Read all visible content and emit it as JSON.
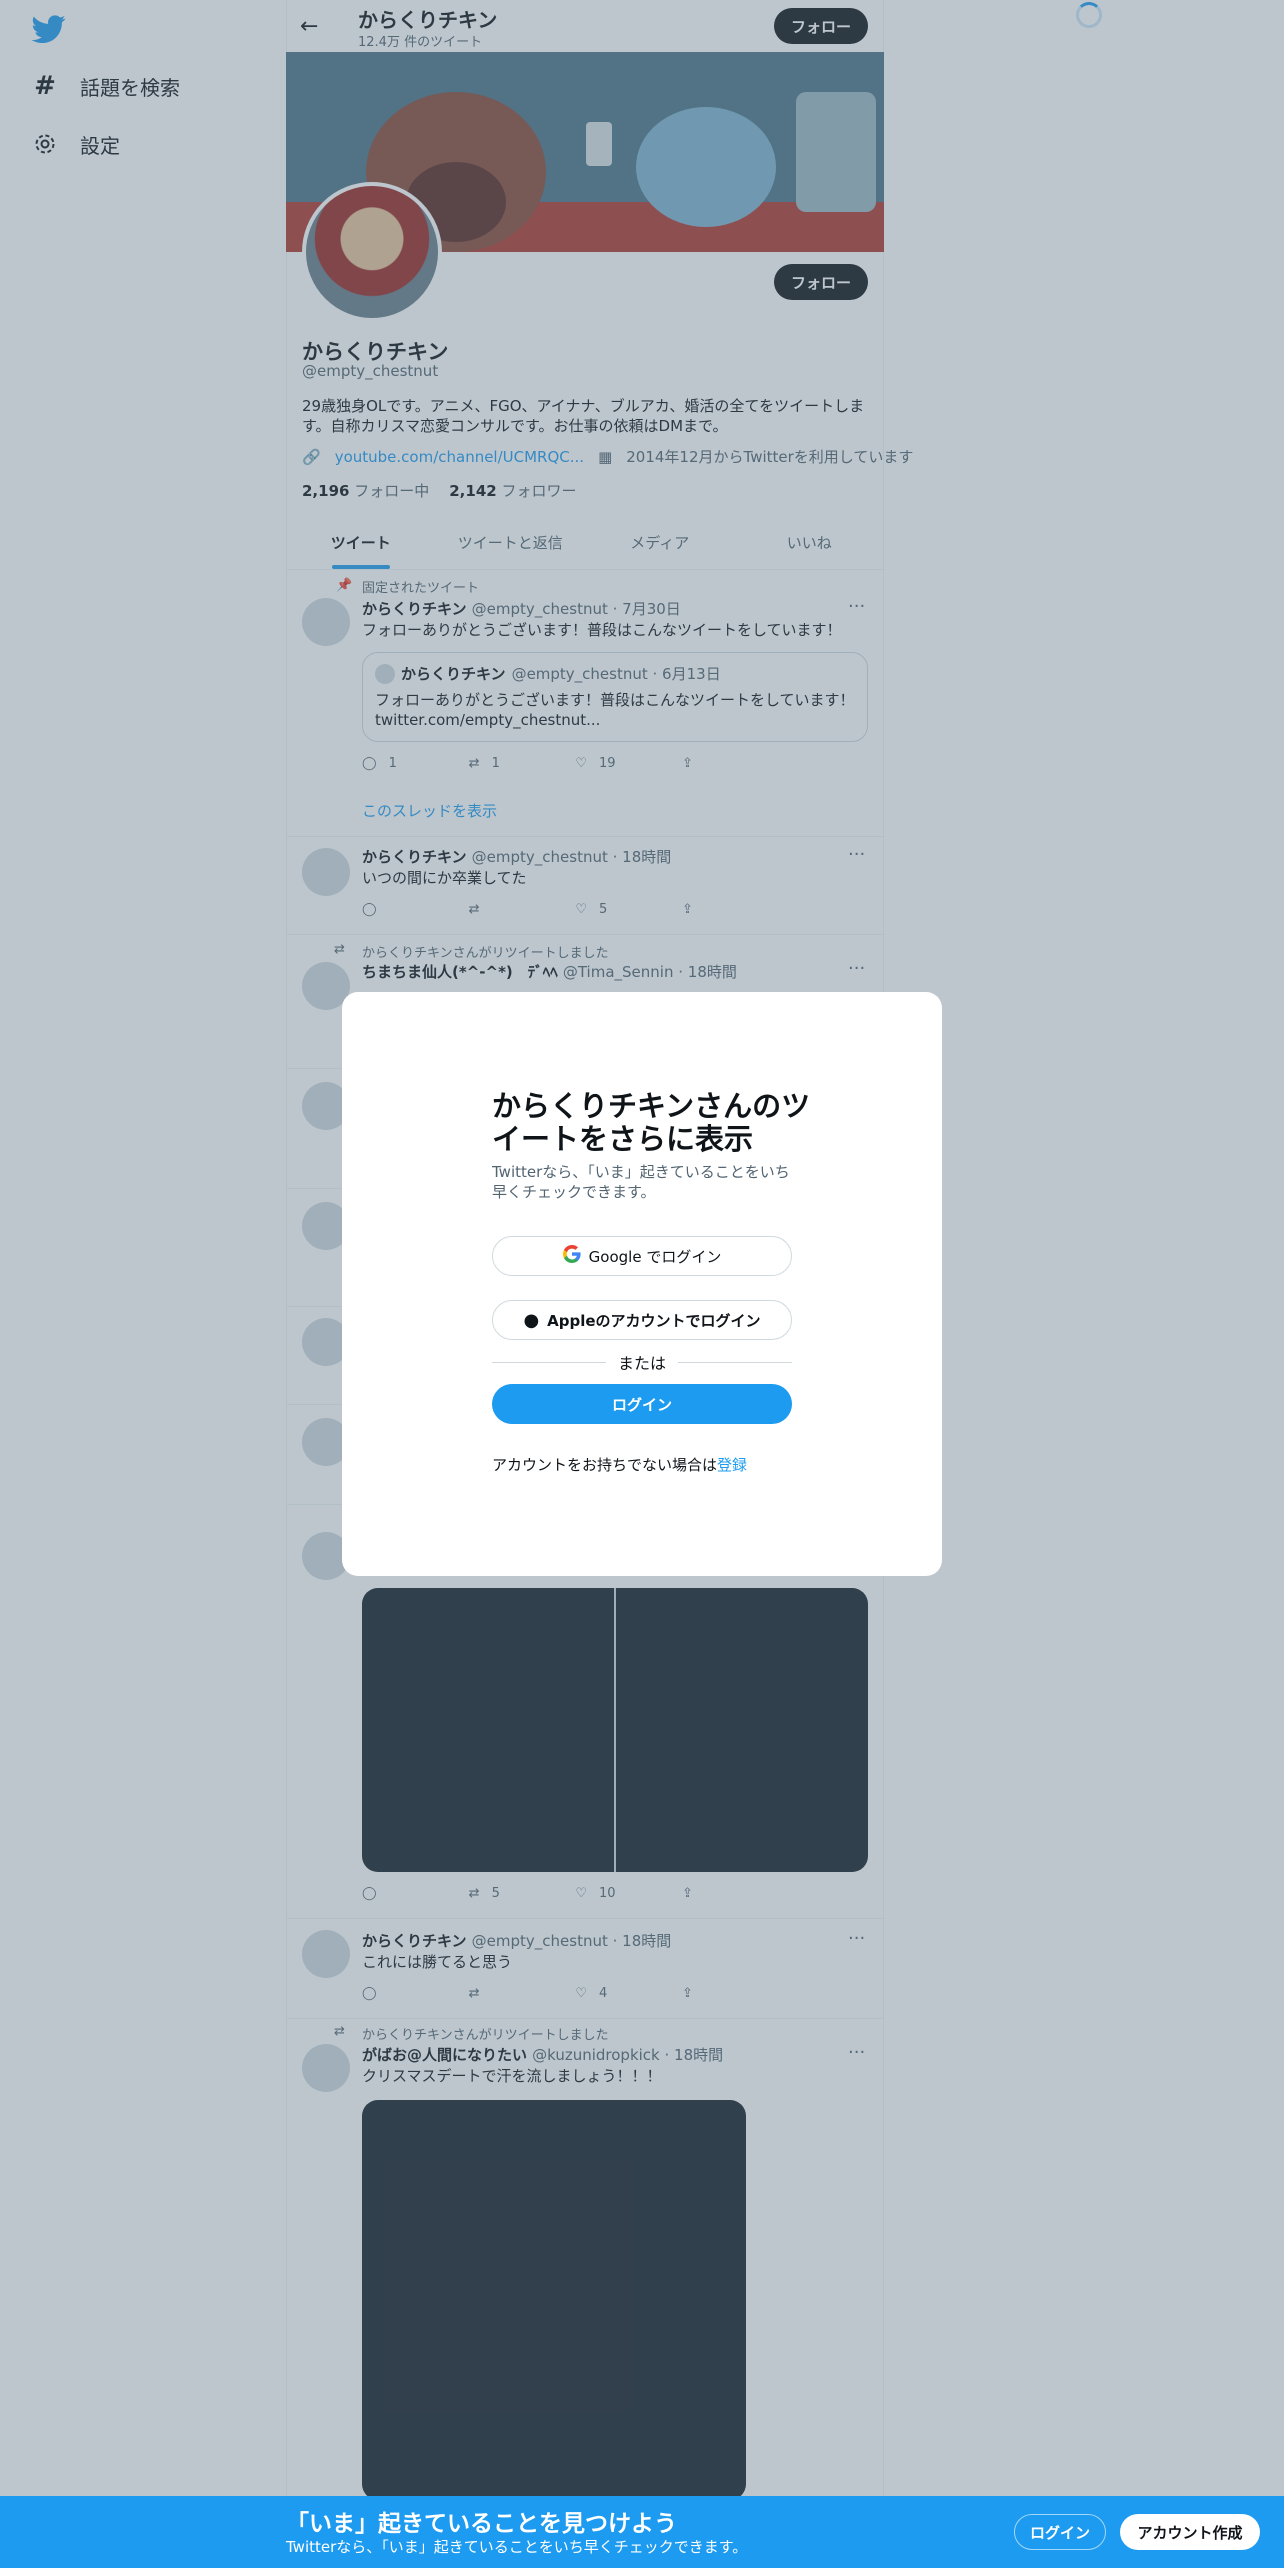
{
  "nav": {
    "logo_icon": "twitter-bird-icon",
    "items": [
      {
        "label": "話題を検索",
        "icon": "hashtag-icon"
      },
      {
        "label": "設定",
        "icon": "gear-icon"
      }
    ]
  },
  "header": {
    "title": "からくりチキン",
    "subtitle": "12.4万 件のツイート",
    "follow_label": "フォロー"
  },
  "profile": {
    "name": "からくりチキン",
    "handle": "@empty_chestnut",
    "bio": "29歳独身OLです。アニメ、FGO、アイナナ、ブルアカ、婚活の全てをツイートします。自称カリスマ恋愛コンサルです。お仕事の依頼はDMまで。",
    "link": "youtube.com/channel/UCMRQC...",
    "joined": "2014年12月からTwitterを利用しています",
    "following_count": "2,196",
    "following_label": "フォロー中",
    "followers_count": "2,142",
    "followers_label": "フォロワー",
    "follow_label": "フォロー"
  },
  "tabs": [
    "ツイート",
    "ツイートと返信",
    "メディア",
    "いいね"
  ],
  "tweets": {
    "pinned_label": "固定されたツイート",
    "t1": {
      "name": "からくりチキン",
      "handle": "@empty_chestnut · 7月30日",
      "text": "フォローありがとうございます！普段はこんなツイートをしています！",
      "replies": "1",
      "retweets": "1",
      "likes": "19"
    },
    "quote": {
      "name": "からくりチキン",
      "handle": "@empty_chestnut · 6月13日",
      "text": "フォローありがとうございます！普段はこんなツイートをしています！",
      "link": "twitter.com/empty_chestnut..."
    },
    "thread_label": "このスレッドを表示",
    "t2": {
      "name": "からくりチキン",
      "handle": "@empty_chestnut · 18時間",
      "text": "いつの間にか卒業してた",
      "likes": "5"
    },
    "rt_label": "からくりチキンさんがリツイートしました",
    "t3": {
      "name": "ちまちま仙人(*^-^*)　ﾃﾞﾍﾍ",
      "handle": "@Tima_Sennin · 18時間"
    },
    "t4": {
      "retweets": "5",
      "likes": "10"
    },
    "t5": {
      "name": "からくりチキン",
      "handle": "@empty_chestnut · 18時間",
      "text": "これには勝てると思う",
      "likes": "4"
    },
    "rt_label2": "からくりチキンさんがリツイートしました",
    "t6": {
      "name": "がばお@人間になりたい",
      "handle": "@kuzunidropkick · 18時間",
      "text": "クリスマスデートで汗を流しましょう！！！"
    }
  },
  "modal": {
    "title": "からくりチキンさんのツイートをさらに表示",
    "subtitle": "Twitterなら、「いま」起きていることをいち早くチェックできます。",
    "google_label": "Google でログイン",
    "apple_label": "Appleのアカウントでログイン",
    "or_label": "または",
    "login_label": "ログイン",
    "signup_prefix": "アカウントをお持ちでない場合は",
    "signup_link": "登録"
  },
  "bottom_bar": {
    "title": "「いま」起きていることを見つけよう",
    "subtitle": "Twitterなら、「いま」起きていることをいち早くチェックできます。",
    "login_label": "ログイン",
    "signup_label": "アカウント作成"
  },
  "colors": {
    "accent": "#1d9bf0",
    "text": "#0f1419",
    "muted": "#536471"
  }
}
